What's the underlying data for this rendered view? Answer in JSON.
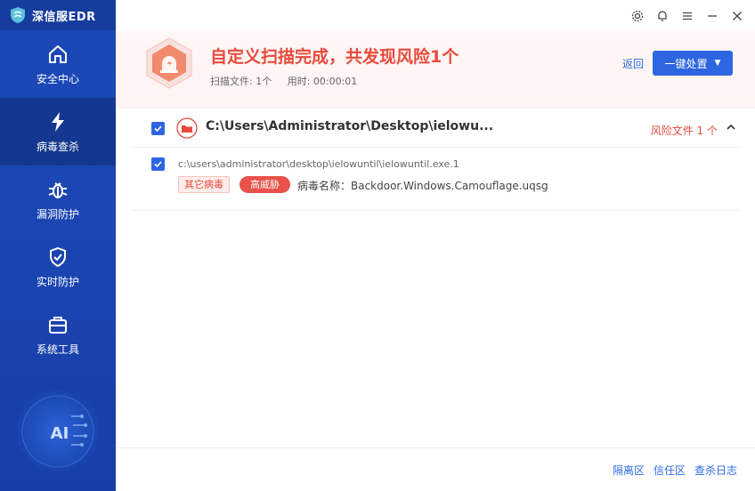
{
  "app": {
    "name": "深信服EDR"
  },
  "sidebar": {
    "items": [
      {
        "label": "安全中心",
        "icon": "home-icon"
      },
      {
        "label": "病毒查杀",
        "icon": "lightning-icon",
        "active": true
      },
      {
        "label": "漏洞防护",
        "icon": "bug-icon"
      },
      {
        "label": "实时防护",
        "icon": "shield-check-icon"
      },
      {
        "label": "系统工具",
        "icon": "toolbox-icon"
      }
    ],
    "ai_badge": "AI"
  },
  "hero": {
    "title": "自定义扫描完成，共发现风险1个",
    "scanned_files": "扫描文件: 1个",
    "elapsed": "用时: 00:00:01",
    "back_label": "返回",
    "action_label": "一键处置"
  },
  "group": {
    "path": "C:\\Users\\Administrator\\Desktop\\ielowu...",
    "risk_count": "风险文件 1 个",
    "checked": true
  },
  "file": {
    "path": "c:\\users\\administrator\\desktop\\ielowuntil\\ielowuntil.exe.1",
    "tag_category": "其它病毒",
    "tag_threat": "高威胁",
    "virus_name": "病毒名称：Backdoor.Windows.Camouflage.uqsg",
    "checked": true
  },
  "footer": {
    "links": [
      "隔离区",
      "信任区",
      "查杀日志"
    ]
  },
  "colors": {
    "sidebar": "#1d48b8",
    "accent": "#2d66e0",
    "danger": "#e84b3c"
  }
}
